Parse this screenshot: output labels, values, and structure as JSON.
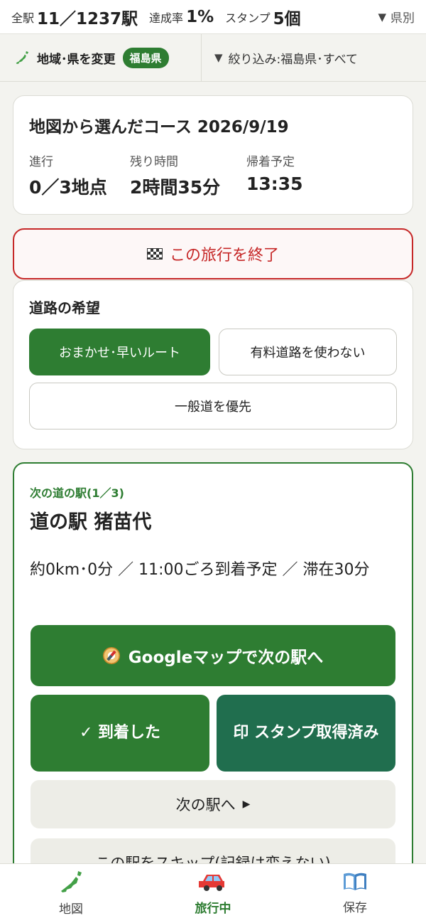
{
  "topbar": {
    "all_label": "全駅",
    "all_value": "11／1237駅",
    "rate_label": "達成率",
    "rate_value": "1%",
    "stamp_label": "スタンプ",
    "stamp_value": "5個",
    "pref_toggle": "県別"
  },
  "filter": {
    "region_button": "地域･県を変更",
    "region_badge": "福島県",
    "filter_text": "絞り込み:福島県･すべて"
  },
  "course": {
    "title": "地図から選んだコース 2026/9/19",
    "progress_label": "進行",
    "progress_value": "0／3地点",
    "remaining_label": "残り時間",
    "remaining_value": "2時間35分",
    "return_label": "帰着予定",
    "return_value": "13:35"
  },
  "end_trip": {
    "label": "この旅行を終了",
    "icon": "checkered-flag-icon"
  },
  "road": {
    "title": "道路の希望",
    "options": [
      "おまかせ･早いルート",
      "有料道路を使わない",
      "一般道を優先"
    ],
    "selected": "おまかせ･早いルート"
  },
  "next": {
    "label": "次の道の駅(1／3)",
    "name": "道の駅 猪苗代",
    "info": "約0km･0分 ／ 11:00ごろ到着予定 ／ 滞在30分",
    "google_button": "Googleマップで次の駅へ",
    "arrived_button": "✓ 到着した",
    "stamp_button": "印 スタンプ取得済み",
    "next_button": "次の駅へ",
    "skip_button": "この駅をスキップ(記録は変えない)"
  },
  "nav": {
    "items": [
      {
        "label": "地図",
        "icon": "japan-map-icon"
      },
      {
        "label": "旅行中",
        "icon": "car-icon"
      },
      {
        "label": "保存",
        "icon": "book-icon"
      }
    ],
    "active": "旅行中"
  },
  "colors": {
    "primary": "#2e7d32",
    "stamp": "#206e4e",
    "danger": "#c62828",
    "background": "#f3f3ef"
  }
}
